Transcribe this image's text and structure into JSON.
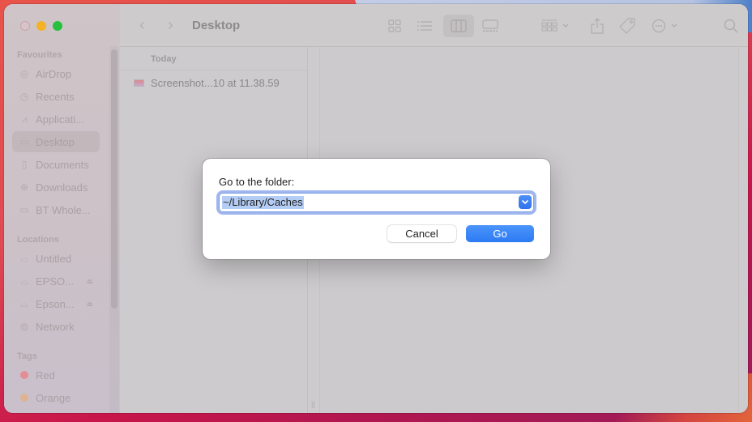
{
  "window": {
    "title": "Desktop"
  },
  "sidebar": {
    "sections": [
      {
        "label": "Favourites",
        "items": [
          {
            "label": "AirDrop",
            "icon": "airdrop-icon"
          },
          {
            "label": "Recents",
            "icon": "clock-icon"
          },
          {
            "label": "Applicati...",
            "icon": "applications-icon"
          },
          {
            "label": "Desktop",
            "icon": "desktop-icon",
            "selected": true
          },
          {
            "label": "Documents",
            "icon": "document-icon"
          },
          {
            "label": "Downloads",
            "icon": "download-icon"
          },
          {
            "label": "BT Whole...",
            "icon": "folder-icon"
          }
        ]
      },
      {
        "label": "Locations",
        "items": [
          {
            "label": "Untitled",
            "icon": "drive-icon"
          },
          {
            "label": "EPSO...",
            "icon": "drive-icon",
            "eject": true
          },
          {
            "label": "Epson...",
            "icon": "drive-icon",
            "eject": true
          },
          {
            "label": "Network",
            "icon": "globe-icon"
          }
        ]
      },
      {
        "label": "Tags",
        "items": [
          {
            "label": "Red",
            "color": "#e78f96"
          },
          {
            "label": "Orange",
            "color": "#e2b48f"
          }
        ]
      }
    ]
  },
  "browser": {
    "group_header": "Today",
    "files": [
      {
        "name": "Screenshot...10 at 11.38.59"
      }
    ]
  },
  "dialog": {
    "label": "Go to the folder:",
    "input_value": "~/Library/Caches",
    "cancel_label": "Cancel",
    "go_label": "Go"
  },
  "toolbar": {
    "icons": [
      "icon-view",
      "list-view",
      "column-view",
      "gallery-view",
      "group-by",
      "share",
      "tags",
      "more-actions",
      "search"
    ]
  }
}
